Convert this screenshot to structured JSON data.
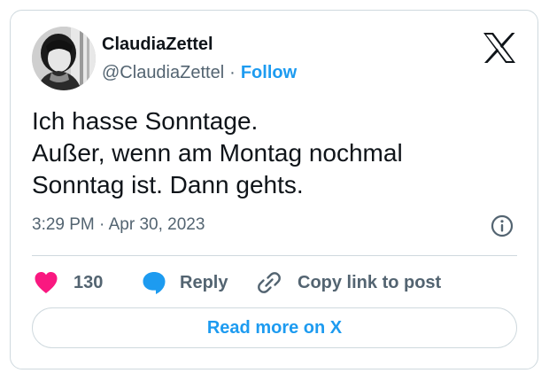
{
  "tweet": {
    "author": {
      "display_name": "ClaudiaZettel",
      "handle": "@ClaudiaZettel",
      "separator": "·",
      "follow_label": "Follow"
    },
    "brand_icon": "x-logo-icon",
    "text_lines": [
      "Ich hasse Sonntage.",
      "Außer, wenn am Montag nochmal",
      "Sonntag ist. Dann gehts."
    ],
    "timestamp": "3:29 PM · Apr 30, 2023",
    "info_icon": "info-circle-icon",
    "actions": {
      "like_count": "130",
      "reply_label": "Reply",
      "copy_label": "Copy link to post"
    },
    "read_more_label": "Read more on X"
  },
  "colors": {
    "accent": "#1d9bf0",
    "like": "#f91880",
    "text": "#0f1419",
    "secondary": "#536471",
    "border": "#cfd9de"
  }
}
